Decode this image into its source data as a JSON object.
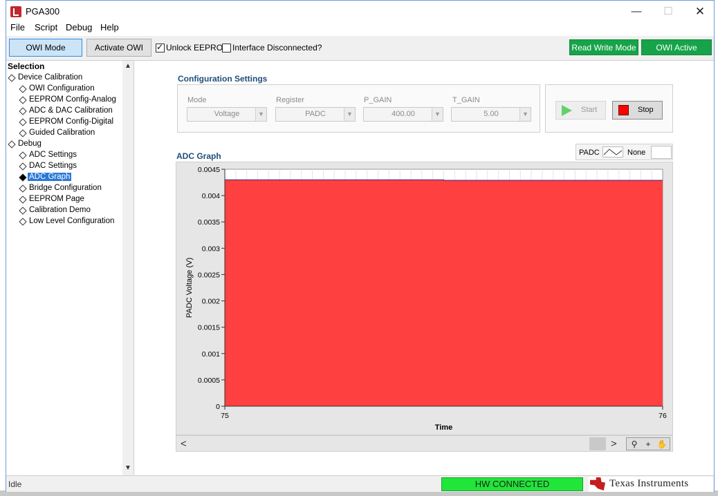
{
  "window": {
    "title": "PGA300"
  },
  "menu": [
    "File",
    "Script",
    "Debug",
    "Help"
  ],
  "toolbar": {
    "owi_mode": "OWI Mode",
    "activate_owi": "Activate OWI",
    "unlock_eeprom": {
      "label": "Unlock EEPROM",
      "checked": true
    },
    "interface_disconnected": {
      "label": "Interface Disconnected?",
      "checked": false
    },
    "read_write_mode": "Read Write Mode",
    "owi_active": "OWI Active",
    "status_color": "#17a34a"
  },
  "sidebar": {
    "header": "Selection",
    "groups": [
      {
        "label": "Device Calibration",
        "items": [
          "OWI Configuration",
          "EEPROM Config-Analog",
          "ADC & DAC Calibration",
          "EEPROM Config-Digital",
          "Guided Calibration"
        ]
      },
      {
        "label": "Debug",
        "items": [
          "ADC Settings",
          "DAC Settings",
          "ADC Graph",
          "Bridge Configuration",
          "EEPROM Page",
          "Calibration Demo",
          "Low Level Configuration"
        ]
      }
    ],
    "selected": "ADC Graph"
  },
  "config": {
    "title": "Configuration Settings",
    "fields": [
      {
        "label": "Mode",
        "value": "Voltage"
      },
      {
        "label": "Register",
        "value": "PADC"
      },
      {
        "label": "P_GAIN",
        "value": "400.00"
      },
      {
        "label": "T_GAIN",
        "value": "5.00"
      }
    ],
    "start_label": "Start",
    "stop_label": "Stop"
  },
  "graph": {
    "title": "ADC Graph",
    "legend": {
      "series": "PADC",
      "none": "None"
    }
  },
  "chart_data": {
    "type": "area",
    "title": "",
    "xlabel": "Time",
    "ylabel": "PADC Voltage (V)",
    "xlim": [
      75,
      76
    ],
    "ylim": [
      0,
      0.0045
    ],
    "x_ticks": [
      "75",
      "76"
    ],
    "y_ticks": [
      "0",
      "0.0005",
      "0.001",
      "0.0015",
      "0.002",
      "0.0025",
      "0.003",
      "0.0035",
      "0.004",
      "0.0045"
    ],
    "series": [
      {
        "name": "PADC",
        "x": [
          75,
          75.5,
          75.5,
          76
        ],
        "y": [
          0.0043,
          0.0043,
          0.00429,
          0.00429
        ],
        "fill_color": "#ff4040",
        "line_color": "#2a2a9a"
      }
    ],
    "grid": true
  },
  "status": {
    "text": "Idle",
    "hw": "HW CONNECTED",
    "hw_color": "#22e53a",
    "logo": "Texas Instruments"
  }
}
